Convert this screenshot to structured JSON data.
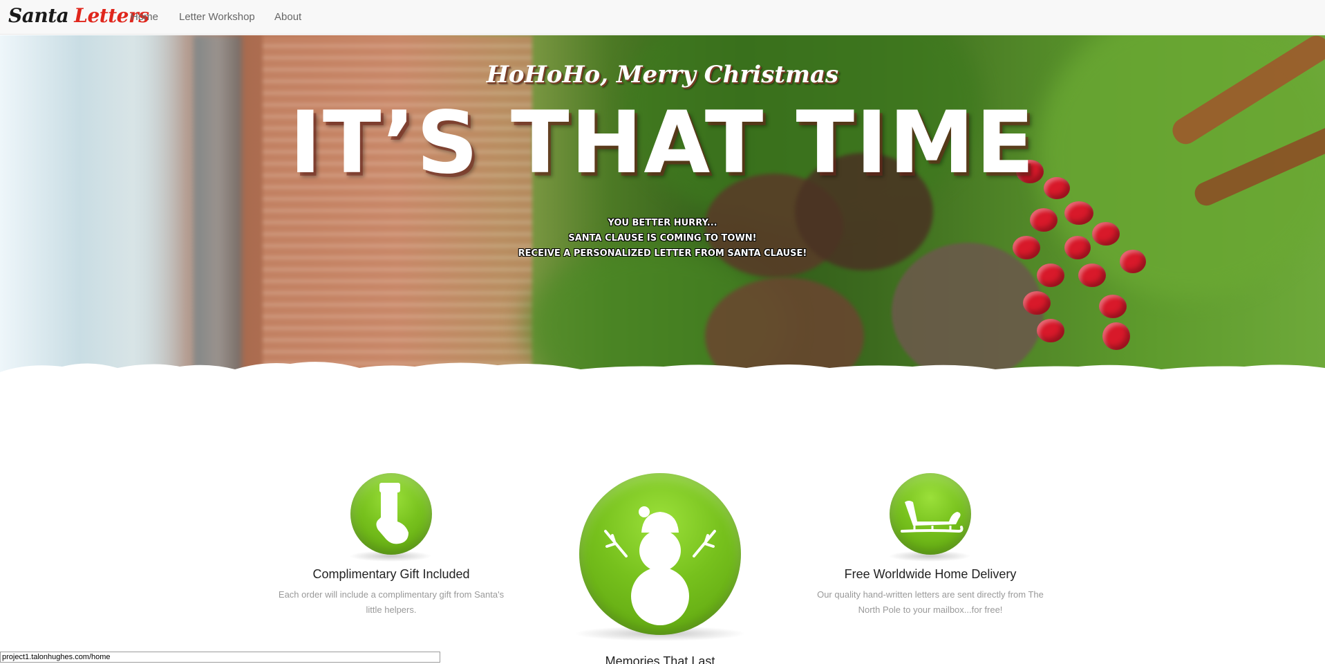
{
  "navbar": {
    "brand_part1": "Santa",
    "brand_part2": "Letters",
    "items": [
      {
        "label": "Home"
      },
      {
        "label": "Letter Workshop"
      },
      {
        "label": "About"
      }
    ]
  },
  "hero": {
    "subtitle": "HoHoHo, Merry Christmas",
    "title": "IT’S THAT TIME",
    "lines": [
      "You better hurry...",
      "Santa Clause is coming to town!",
      "Receive a personalized letter from Santa Clause!"
    ]
  },
  "features": [
    {
      "icon": "stocking-icon",
      "title": "Complimentary Gift Included",
      "text": "Each order will include a complimentary gift from Santa's little helpers."
    },
    {
      "icon": "snowman-icon",
      "title": "Memories That Last",
      "text": ""
    },
    {
      "icon": "sleigh-icon",
      "title": "Free Worldwide Home Delivery",
      "text": "Our quality hand-written letters are sent directly from The North Pole to your mailbox...for free!"
    }
  ],
  "colors": {
    "brand_accent": "#e0261c",
    "icon_green": "#77c11d",
    "berry_red": "#d8192a"
  },
  "status_url": "project1.talonhughes.com/home"
}
